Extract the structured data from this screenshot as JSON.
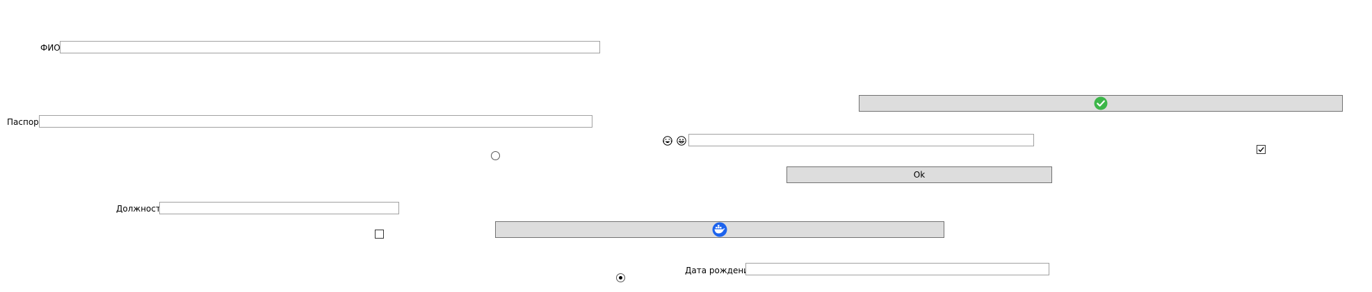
{
  "form": {
    "fio_label": "ФИО",
    "fio_value": "",
    "passport_label": "Паспорт",
    "passport_value": "",
    "position_label": "Должность",
    "position_value": "",
    "birthdate_label": "Дата рождения",
    "birthdate_value": "",
    "emoji_field_value": ""
  },
  "buttons": {
    "ok_label": "Ok",
    "confirm_icon": "check-circle-icon",
    "docker_icon": "docker-whale-icon"
  },
  "icons": {
    "emoji_1": "face-with-tears-of-joy-icon",
    "emoji_2": "grinning-face-icon"
  },
  "checkboxes": {
    "right_checkbox_checked": true,
    "left_checkbox_checked": false
  },
  "radios": {
    "top_radio_selected": false,
    "bottom_radio_selected": true
  },
  "colors": {
    "check_green": "#3cb649",
    "docker_blue": "#1d63ed",
    "button_bg": "#dddddd"
  }
}
